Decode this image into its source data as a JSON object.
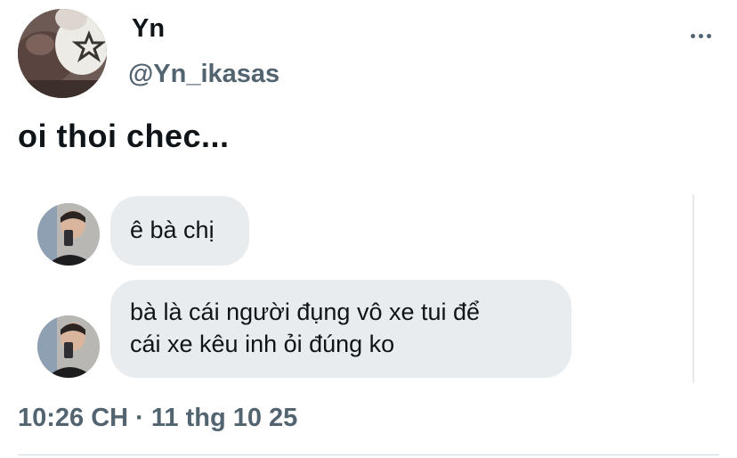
{
  "author": {
    "display_name": "Yn",
    "handle": "@Yn_ikasas"
  },
  "tweet": {
    "text": "oi thoi chec...",
    "timestamp": "10:26 CH · 11 thg 10 25"
  },
  "embedded_chat": {
    "messages": [
      {
        "text": "ê bà chị"
      },
      {
        "text": "bà là cái người đụng vô xe tui để\ncái xe kêu inh ỏi đúng ko"
      }
    ]
  },
  "icons": {
    "more": "more-horizontal-icon"
  }
}
